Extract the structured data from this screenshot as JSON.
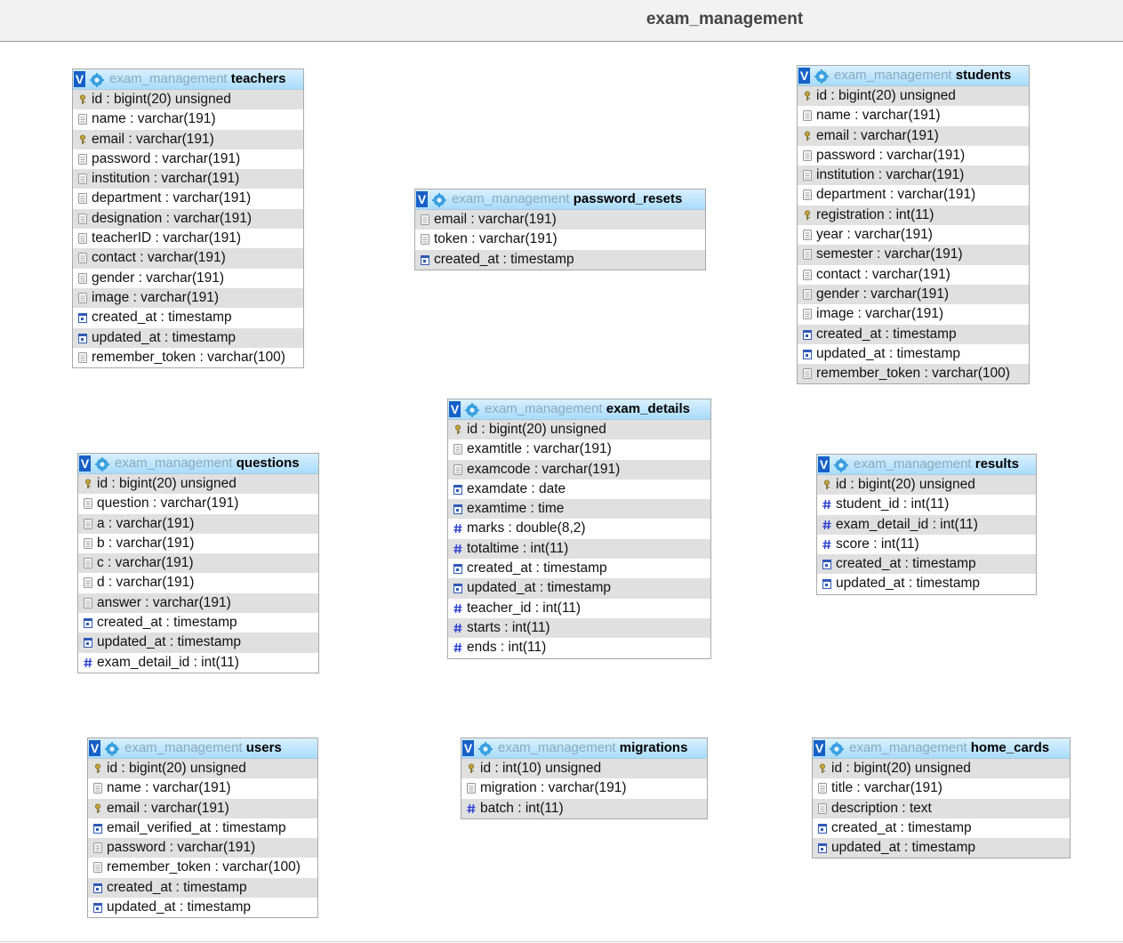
{
  "page": {
    "title": "exam_management"
  },
  "db_prefix": "exam_management",
  "tables": [
    {
      "name": "teachers",
      "columns": [
        {
          "text": "id : bigint(20) unsigned",
          "icon": "key-icon"
        },
        {
          "text": "name : varchar(191)",
          "icon": "text-field-icon"
        },
        {
          "text": "email : varchar(191)",
          "icon": "key-icon"
        },
        {
          "text": "password : varchar(191)",
          "icon": "text-field-icon"
        },
        {
          "text": "institution : varchar(191)",
          "icon": "text-field-icon"
        },
        {
          "text": "department : varchar(191)",
          "icon": "text-field-icon"
        },
        {
          "text": "designation : varchar(191)",
          "icon": "text-field-icon"
        },
        {
          "text": "teacherID : varchar(191)",
          "icon": "text-field-icon"
        },
        {
          "text": "contact : varchar(191)",
          "icon": "text-field-icon"
        },
        {
          "text": "gender : varchar(191)",
          "icon": "text-field-icon"
        },
        {
          "text": "image : varchar(191)",
          "icon": "text-field-icon"
        },
        {
          "text": "created_at : timestamp",
          "icon": "date-field-icon"
        },
        {
          "text": "updated_at : timestamp",
          "icon": "date-field-icon"
        },
        {
          "text": "remember_token : varchar(100)",
          "icon": "text-field-icon"
        }
      ]
    },
    {
      "name": "password_resets",
      "columns": [
        {
          "text": "email : varchar(191)",
          "icon": "text-field-icon"
        },
        {
          "text": "token : varchar(191)",
          "icon": "text-field-icon"
        },
        {
          "text": "created_at : timestamp",
          "icon": "date-field-icon"
        }
      ]
    },
    {
      "name": "students",
      "columns": [
        {
          "text": "id : bigint(20) unsigned",
          "icon": "key-icon"
        },
        {
          "text": "name : varchar(191)",
          "icon": "text-field-icon"
        },
        {
          "text": "email : varchar(191)",
          "icon": "key-icon"
        },
        {
          "text": "password : varchar(191)",
          "icon": "text-field-icon"
        },
        {
          "text": "institution : varchar(191)",
          "icon": "text-field-icon"
        },
        {
          "text": "department : varchar(191)",
          "icon": "text-field-icon"
        },
        {
          "text": "registration : int(11)",
          "icon": "key-icon"
        },
        {
          "text": "year : varchar(191)",
          "icon": "text-field-icon"
        },
        {
          "text": "semester : varchar(191)",
          "icon": "text-field-icon"
        },
        {
          "text": "contact : varchar(191)",
          "icon": "text-field-icon"
        },
        {
          "text": "gender : varchar(191)",
          "icon": "text-field-icon"
        },
        {
          "text": "image : varchar(191)",
          "icon": "text-field-icon"
        },
        {
          "text": "created_at : timestamp",
          "icon": "date-field-icon"
        },
        {
          "text": "updated_at : timestamp",
          "icon": "date-field-icon"
        },
        {
          "text": "remember_token : varchar(100)",
          "icon": "text-field-icon"
        }
      ]
    },
    {
      "name": "exam_details",
      "columns": [
        {
          "text": "id : bigint(20) unsigned",
          "icon": "key-icon"
        },
        {
          "text": "examtitle : varchar(191)",
          "icon": "text-field-icon"
        },
        {
          "text": "examcode : varchar(191)",
          "icon": "text-field-icon"
        },
        {
          "text": "examdate : date",
          "icon": "date-field-icon"
        },
        {
          "text": "examtime : time",
          "icon": "date-field-icon"
        },
        {
          "text": "marks : double(8,2)",
          "icon": "number-field-icon"
        },
        {
          "text": "totaltime : int(11)",
          "icon": "number-field-icon"
        },
        {
          "text": "created_at : timestamp",
          "icon": "date-field-icon"
        },
        {
          "text": "updated_at : timestamp",
          "icon": "date-field-icon"
        },
        {
          "text": "teacher_id : int(11)",
          "icon": "number-field-icon"
        },
        {
          "text": "starts : int(11)",
          "icon": "number-field-icon"
        },
        {
          "text": "ends : int(11)",
          "icon": "number-field-icon"
        }
      ]
    },
    {
      "name": "questions",
      "columns": [
        {
          "text": "id : bigint(20) unsigned",
          "icon": "key-icon"
        },
        {
          "text": "question : varchar(191)",
          "icon": "text-field-icon"
        },
        {
          "text": "a : varchar(191)",
          "icon": "text-field-icon"
        },
        {
          "text": "b : varchar(191)",
          "icon": "text-field-icon"
        },
        {
          "text": "c : varchar(191)",
          "icon": "text-field-icon"
        },
        {
          "text": "d : varchar(191)",
          "icon": "text-field-icon"
        },
        {
          "text": "answer : varchar(191)",
          "icon": "text-field-icon"
        },
        {
          "text": "created_at : timestamp",
          "icon": "date-field-icon"
        },
        {
          "text": "updated_at : timestamp",
          "icon": "date-field-icon"
        },
        {
          "text": "exam_detail_id : int(11)",
          "icon": "number-field-icon"
        }
      ]
    },
    {
      "name": "results",
      "columns": [
        {
          "text": "id : bigint(20) unsigned",
          "icon": "key-icon"
        },
        {
          "text": "student_id : int(11)",
          "icon": "number-field-icon"
        },
        {
          "text": "exam_detail_id : int(11)",
          "icon": "number-field-icon"
        },
        {
          "text": "score : int(11)",
          "icon": "number-field-icon"
        },
        {
          "text": "created_at : timestamp",
          "icon": "date-field-icon"
        },
        {
          "text": "updated_at : timestamp",
          "icon": "date-field-icon"
        }
      ]
    },
    {
      "name": "users",
      "columns": [
        {
          "text": "id : bigint(20) unsigned",
          "icon": "key-icon"
        },
        {
          "text": "name : varchar(191)",
          "icon": "text-field-icon"
        },
        {
          "text": "email : varchar(191)",
          "icon": "key-icon"
        },
        {
          "text": "email_verified_at : timestamp",
          "icon": "date-field-icon"
        },
        {
          "text": "password : varchar(191)",
          "icon": "text-field-icon"
        },
        {
          "text": "remember_token : varchar(100)",
          "icon": "text-field-icon"
        },
        {
          "text": "created_at : timestamp",
          "icon": "date-field-icon"
        },
        {
          "text": "updated_at : timestamp",
          "icon": "date-field-icon"
        }
      ]
    },
    {
      "name": "migrations",
      "columns": [
        {
          "text": "id : int(10) unsigned",
          "icon": "key-icon"
        },
        {
          "text": "migration : varchar(191)",
          "icon": "text-field-icon"
        },
        {
          "text": "batch : int(11)",
          "icon": "number-field-icon"
        }
      ]
    },
    {
      "name": "home_cards",
      "columns": [
        {
          "text": "id : bigint(20) unsigned",
          "icon": "key-icon"
        },
        {
          "text": "title : varchar(191)",
          "icon": "text-field-icon"
        },
        {
          "text": "description : text",
          "icon": "text-field-icon"
        },
        {
          "text": "created_at : timestamp",
          "icon": "date-field-icon"
        },
        {
          "text": "updated_at : timestamp",
          "icon": "date-field-icon"
        }
      ]
    }
  ]
}
